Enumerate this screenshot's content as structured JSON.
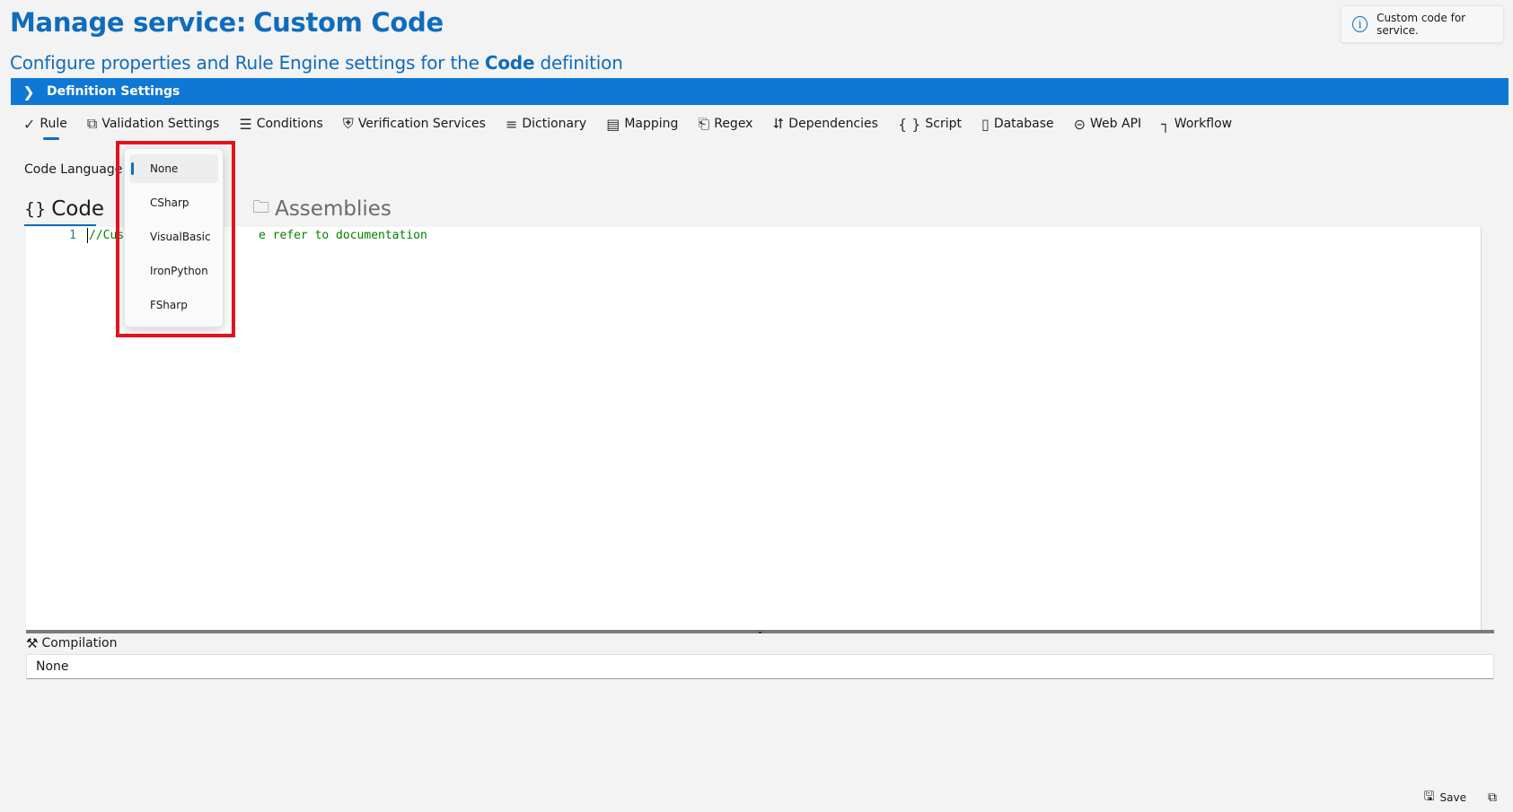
{
  "header": {
    "title_prefix": "Manage service:",
    "title_name": "Custom Code",
    "subtitle_prefix": "Configure properties and Rule Engine settings for the",
    "subtitle_bold": "Code",
    "subtitle_suffix": "definition",
    "info_icon": "info-icon",
    "info_text": "Custom code for service."
  },
  "definition_bar": {
    "label": "Definition Settings",
    "icon": "chevron-right-icon"
  },
  "toolbar": {
    "items": [
      {
        "label": "Rule",
        "icon": "checkmark-icon"
      },
      {
        "label": "Validation Settings",
        "icon": "validation-icon"
      },
      {
        "label": "Conditions",
        "icon": "list-icon"
      },
      {
        "label": "Verification Services",
        "icon": "shield-icon"
      },
      {
        "label": "Dictionary",
        "icon": "list-icon"
      },
      {
        "label": "Mapping",
        "icon": "document-icon"
      },
      {
        "label": "Regex",
        "icon": "regex-icon"
      },
      {
        "label": "Dependencies",
        "icon": "share-icon"
      },
      {
        "label": "Script",
        "icon": "braces-icon"
      },
      {
        "label": "Database",
        "icon": "phone-icon"
      },
      {
        "label": "Web API",
        "icon": "web-icon"
      },
      {
        "label": "Workflow",
        "icon": "workflow-icon"
      }
    ]
  },
  "code_language": {
    "label": "Code Language:",
    "options": [
      "None",
      "CSharp",
      "VisualBasic",
      "IronPython",
      "FSharp"
    ],
    "selected": "None"
  },
  "tabs": {
    "code": "Code",
    "assemblies": "Assemblies"
  },
  "editor": {
    "line_number": "1",
    "line_visible_left": "//Cust",
    "line_visible_right": "e refer to documentation"
  },
  "compilation": {
    "label": "Compilation",
    "value": "None"
  },
  "footer": {
    "save_label": "Save"
  },
  "colors": {
    "accent": "#0f6cbd",
    "bar": "#0f78d4",
    "highlight": "#e0141e",
    "code_comment": "#008000"
  }
}
